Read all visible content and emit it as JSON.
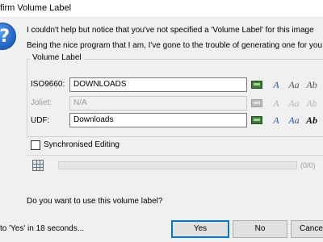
{
  "window": {
    "title": "firm Volume Label"
  },
  "dialog": {
    "icon": "question-icon",
    "message_line1": "I couldn't help but notice that you've not specified a 'Volume Label' for this image",
    "message_line2": "Being the nice program that I am, I've gone to the trouble of generating one for you"
  },
  "volume_label": {
    "group_title": "Volume Label",
    "rows": [
      {
        "label": "ISO9660:",
        "value": "DOWNLOADS",
        "enabled": true,
        "icons": [
          "drive-icon",
          "uppercase-icon",
          "lowercase-icon",
          "titlecase-icon"
        ]
      },
      {
        "label": "Joliet:",
        "value": "N/A",
        "enabled": false,
        "icons": [
          "drive-icon",
          "uppercase-icon",
          "lowercase-icon",
          "titlecase-icon"
        ]
      },
      {
        "label": "UDF:",
        "value": "Downloads",
        "enabled": true,
        "icons": [
          "drive-icon",
          "uppercase-icon",
          "lowercase-icon",
          "titlecase-icon"
        ]
      }
    ],
    "case_glyphs": [
      "A",
      "Aa",
      "Ab"
    ]
  },
  "sync": {
    "label": "Synchronised Editing",
    "checked": false
  },
  "progress": {
    "count_text": "(0/0)",
    "fraction": 0
  },
  "question": "Do you want to use this volume label?",
  "footer": {
    "countdown": "to 'Yes' in 18 seconds...",
    "yes_label": "Yes",
    "no_label": "No",
    "cancel_label": "Cancel"
  },
  "colors": {
    "accent": "#0078d7",
    "progress": "#06b025",
    "disabled_text": "#9a9a9a"
  }
}
